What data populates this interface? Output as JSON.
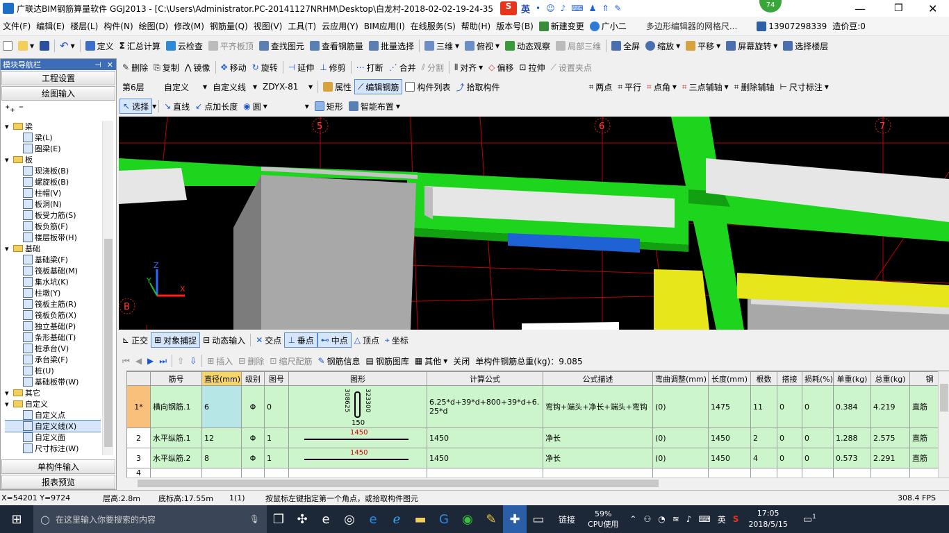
{
  "titlebar": {
    "title": "广联达BIM钢筋算量软件 GGJ2013 - [C:\\Users\\Administrator.PC-20141127NRHM\\Desktop\\白龙村-2018-02-02-19-24-35",
    "badge": "74",
    "ime": "英"
  },
  "menu": [
    "文件(F)",
    "编辑(E)",
    "楼层(L)",
    "构件(N)",
    "绘图(D)",
    "修改(M)",
    "钢筋量(Q)",
    "视图(V)",
    "工具(T)",
    "云应用(Y)",
    "BIM应用(I)",
    "在线服务(S)",
    "帮助(H)",
    "版本号(B)",
    "新建变更",
    "广小二"
  ],
  "menu_right": {
    "notice": "多边形编辑器的网格尺...",
    "phone": "13907298339",
    "price": "造价豆:0"
  },
  "toolbar1": [
    "定义",
    "汇总计算",
    "云检查",
    "平齐板顶",
    "查找图元",
    "查看钢筋量",
    "批量选择",
    "三维",
    "俯视",
    "动态观察",
    "局部三维",
    "全屏",
    "缩放",
    "平移",
    "屏幕旋转",
    "选择楼层"
  ],
  "panel": {
    "title": "模块导航栏",
    "btn_project": "工程设置",
    "btn_draw": "绘图输入",
    "btn_single": "单构件输入",
    "btn_report": "报表预览",
    "tree": [
      {
        "t": "梁",
        "lv": 0,
        "f": true
      },
      {
        "t": "梁(L)",
        "lv": 1
      },
      {
        "t": "圈梁(E)",
        "lv": 1
      },
      {
        "t": "板",
        "lv": 0,
        "f": true
      },
      {
        "t": "现浇板(B)",
        "lv": 1
      },
      {
        "t": "螺旋板(B)",
        "lv": 1
      },
      {
        "t": "柱帽(V)",
        "lv": 1
      },
      {
        "t": "板洞(N)",
        "lv": 1
      },
      {
        "t": "板受力筋(S)",
        "lv": 1
      },
      {
        "t": "板负筋(F)",
        "lv": 1
      },
      {
        "t": "楼层板带(H)",
        "lv": 1
      },
      {
        "t": "基础",
        "lv": 0,
        "f": true
      },
      {
        "t": "基础梁(F)",
        "lv": 1
      },
      {
        "t": "筏板基础(M)",
        "lv": 1
      },
      {
        "t": "集水坑(K)",
        "lv": 1
      },
      {
        "t": "柱墩(Y)",
        "lv": 1
      },
      {
        "t": "筏板主筋(R)",
        "lv": 1
      },
      {
        "t": "筏板负筋(X)",
        "lv": 1
      },
      {
        "t": "独立基础(P)",
        "lv": 1
      },
      {
        "t": "条形基础(T)",
        "lv": 1
      },
      {
        "t": "桩承台(V)",
        "lv": 1
      },
      {
        "t": "承台梁(F)",
        "lv": 1
      },
      {
        "t": "桩(U)",
        "lv": 1
      },
      {
        "t": "基础板带(W)",
        "lv": 1
      },
      {
        "t": "其它",
        "lv": 0,
        "f": true
      },
      {
        "t": "自定义",
        "lv": 0,
        "f": true
      },
      {
        "t": "自定义点",
        "lv": 1
      },
      {
        "t": "自定义线(X)",
        "lv": 1,
        "sel": true
      },
      {
        "t": "自定义面",
        "lv": 1
      },
      {
        "t": "尺寸标注(W)",
        "lv": 1
      }
    ]
  },
  "toolbar2": [
    "删除",
    "复制",
    "镜像",
    "移动",
    "旋转",
    "延伸",
    "修剪",
    "打断",
    "合并",
    "分割",
    "对齐",
    "偏移",
    "拉伸",
    "设置夹点"
  ],
  "toolbar3": {
    "floor": "第6层",
    "type": "自定义",
    "subtype": "自定义线",
    "name": "ZDYX-81",
    "items": [
      "属性",
      "编辑钢筋",
      "构件列表",
      "拾取构件"
    ],
    "axis": [
      "两点",
      "平行",
      "点角",
      "三点辅轴",
      "删除辅轴",
      "尺寸标注"
    ]
  },
  "toolbar4": [
    "选择",
    "直线",
    "点加长度",
    "圆",
    "矩形",
    "智能布置"
  ],
  "viewport": {
    "axis_labels": [
      "5",
      "6",
      "7",
      "B"
    ],
    "axes": {
      "z": "Z",
      "y": "Y",
      "x": "X"
    }
  },
  "snapbar": [
    "正交",
    "对象捕捉",
    "动态输入",
    "交点",
    "垂点",
    "中点",
    "顶点",
    "坐标"
  ],
  "gridbar": {
    "items": [
      "插入",
      "删除",
      "缩尺配筋",
      "钢筋信息",
      "钢筋图库",
      "其他",
      "关闭"
    ],
    "total": "单构件钢筋总重(kg)：9.085"
  },
  "table": {
    "headers": [
      "",
      "筋号",
      "直径(mm)",
      "级别",
      "图号",
      "图形",
      "计算公式",
      "公式描述",
      "弯曲调整(mm)",
      "长度(mm)",
      "根数",
      "搭接",
      "损耗(%)",
      "单重(kg)",
      "总重(kg)",
      "钢"
    ],
    "rows": [
      {
        "no": "1*",
        "name": "横向钢筋.1",
        "dia": "6",
        "grade": "Φ",
        "fig": "0",
        "shape_a": "308625",
        "shape_b": "323300",
        "shape_c": "150",
        "formula": "6.25*d+39*d+800+39*d+6.25*d",
        "desc": "弯钩+端头+净长+端头+弯钩",
        "bend": "(0)",
        "len": "1475",
        "count": "11",
        "lap": "0",
        "loss": "0",
        "unit": "0.384",
        "total": "4.219",
        "last": "直筋"
      },
      {
        "no": "2",
        "name": "水平纵筋.1",
        "dia": "12",
        "grade": "Φ",
        "fig": "1",
        "shape_a": "1450",
        "formula": "1450",
        "desc": "净长",
        "bend": "(0)",
        "len": "1450",
        "count": "2",
        "lap": "0",
        "loss": "0",
        "unit": "1.288",
        "total": "2.575",
        "last": "直筋"
      },
      {
        "no": "3",
        "name": "水平纵筋.2",
        "dia": "8",
        "grade": "Φ",
        "fig": "1",
        "shape_a": "1450",
        "formula": "1450",
        "desc": "净长",
        "bend": "(0)",
        "len": "1450",
        "count": "4",
        "lap": "0",
        "loss": "0",
        "unit": "0.573",
        "total": "2.291",
        "last": "直筋"
      },
      {
        "no": "4"
      }
    ]
  },
  "status": {
    "coords": "X=54201 Y=9724",
    "floor_h": "层高:2.8m",
    "base_h": "底标高:17.55m",
    "count": "1(1)",
    "hint": "按鼠标左键指定第一个角点，或拾取构件图元",
    "fps": "308.4 FPS"
  },
  "taskbar": {
    "search": "在这里输入你要搜索的内容",
    "link": "链接",
    "cpu": "59%",
    "cpu_label": "CPU使用",
    "ime": "英",
    "time": "17:05",
    "date": "2018/5/15",
    "notif": "1"
  },
  "colors": {
    "green": "#1ed51e",
    "grey": "#a8a8a8",
    "white": "#e6e6e6",
    "yellow": "#e6e61a",
    "blue": "#1f62d6",
    "sel": "#ccf5cc"
  }
}
